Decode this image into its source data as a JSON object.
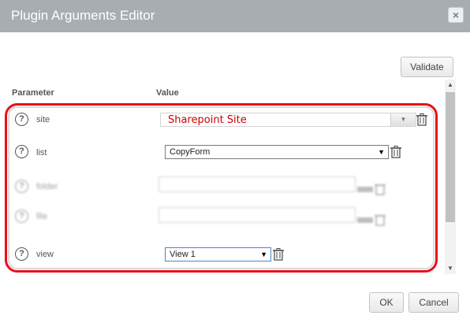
{
  "dialog": {
    "title": "Plugin Arguments Editor",
    "close_glyph": "×"
  },
  "toolbar": {
    "validate_label": "Validate"
  },
  "columns": {
    "parameter": "Parameter",
    "value": "Value"
  },
  "params": [
    {
      "label": "site",
      "value": "Sharepoint Site",
      "control": "combo"
    },
    {
      "label": "list",
      "value": "CopyForm",
      "control": "select"
    },
    {
      "label": "folder",
      "value": "",
      "control": "text",
      "disabled": true
    },
    {
      "label": "file",
      "value": "",
      "control": "text",
      "disabled": true
    },
    {
      "label": "view",
      "value": "View 1",
      "control": "select"
    }
  ],
  "help_glyph": "?",
  "footer": {
    "ok_label": "OK",
    "cancel_label": "Cancel"
  },
  "colors": {
    "highlight": "#e8101a",
    "title_bar": "#a8adb2",
    "site_text": "#cc0000"
  }
}
